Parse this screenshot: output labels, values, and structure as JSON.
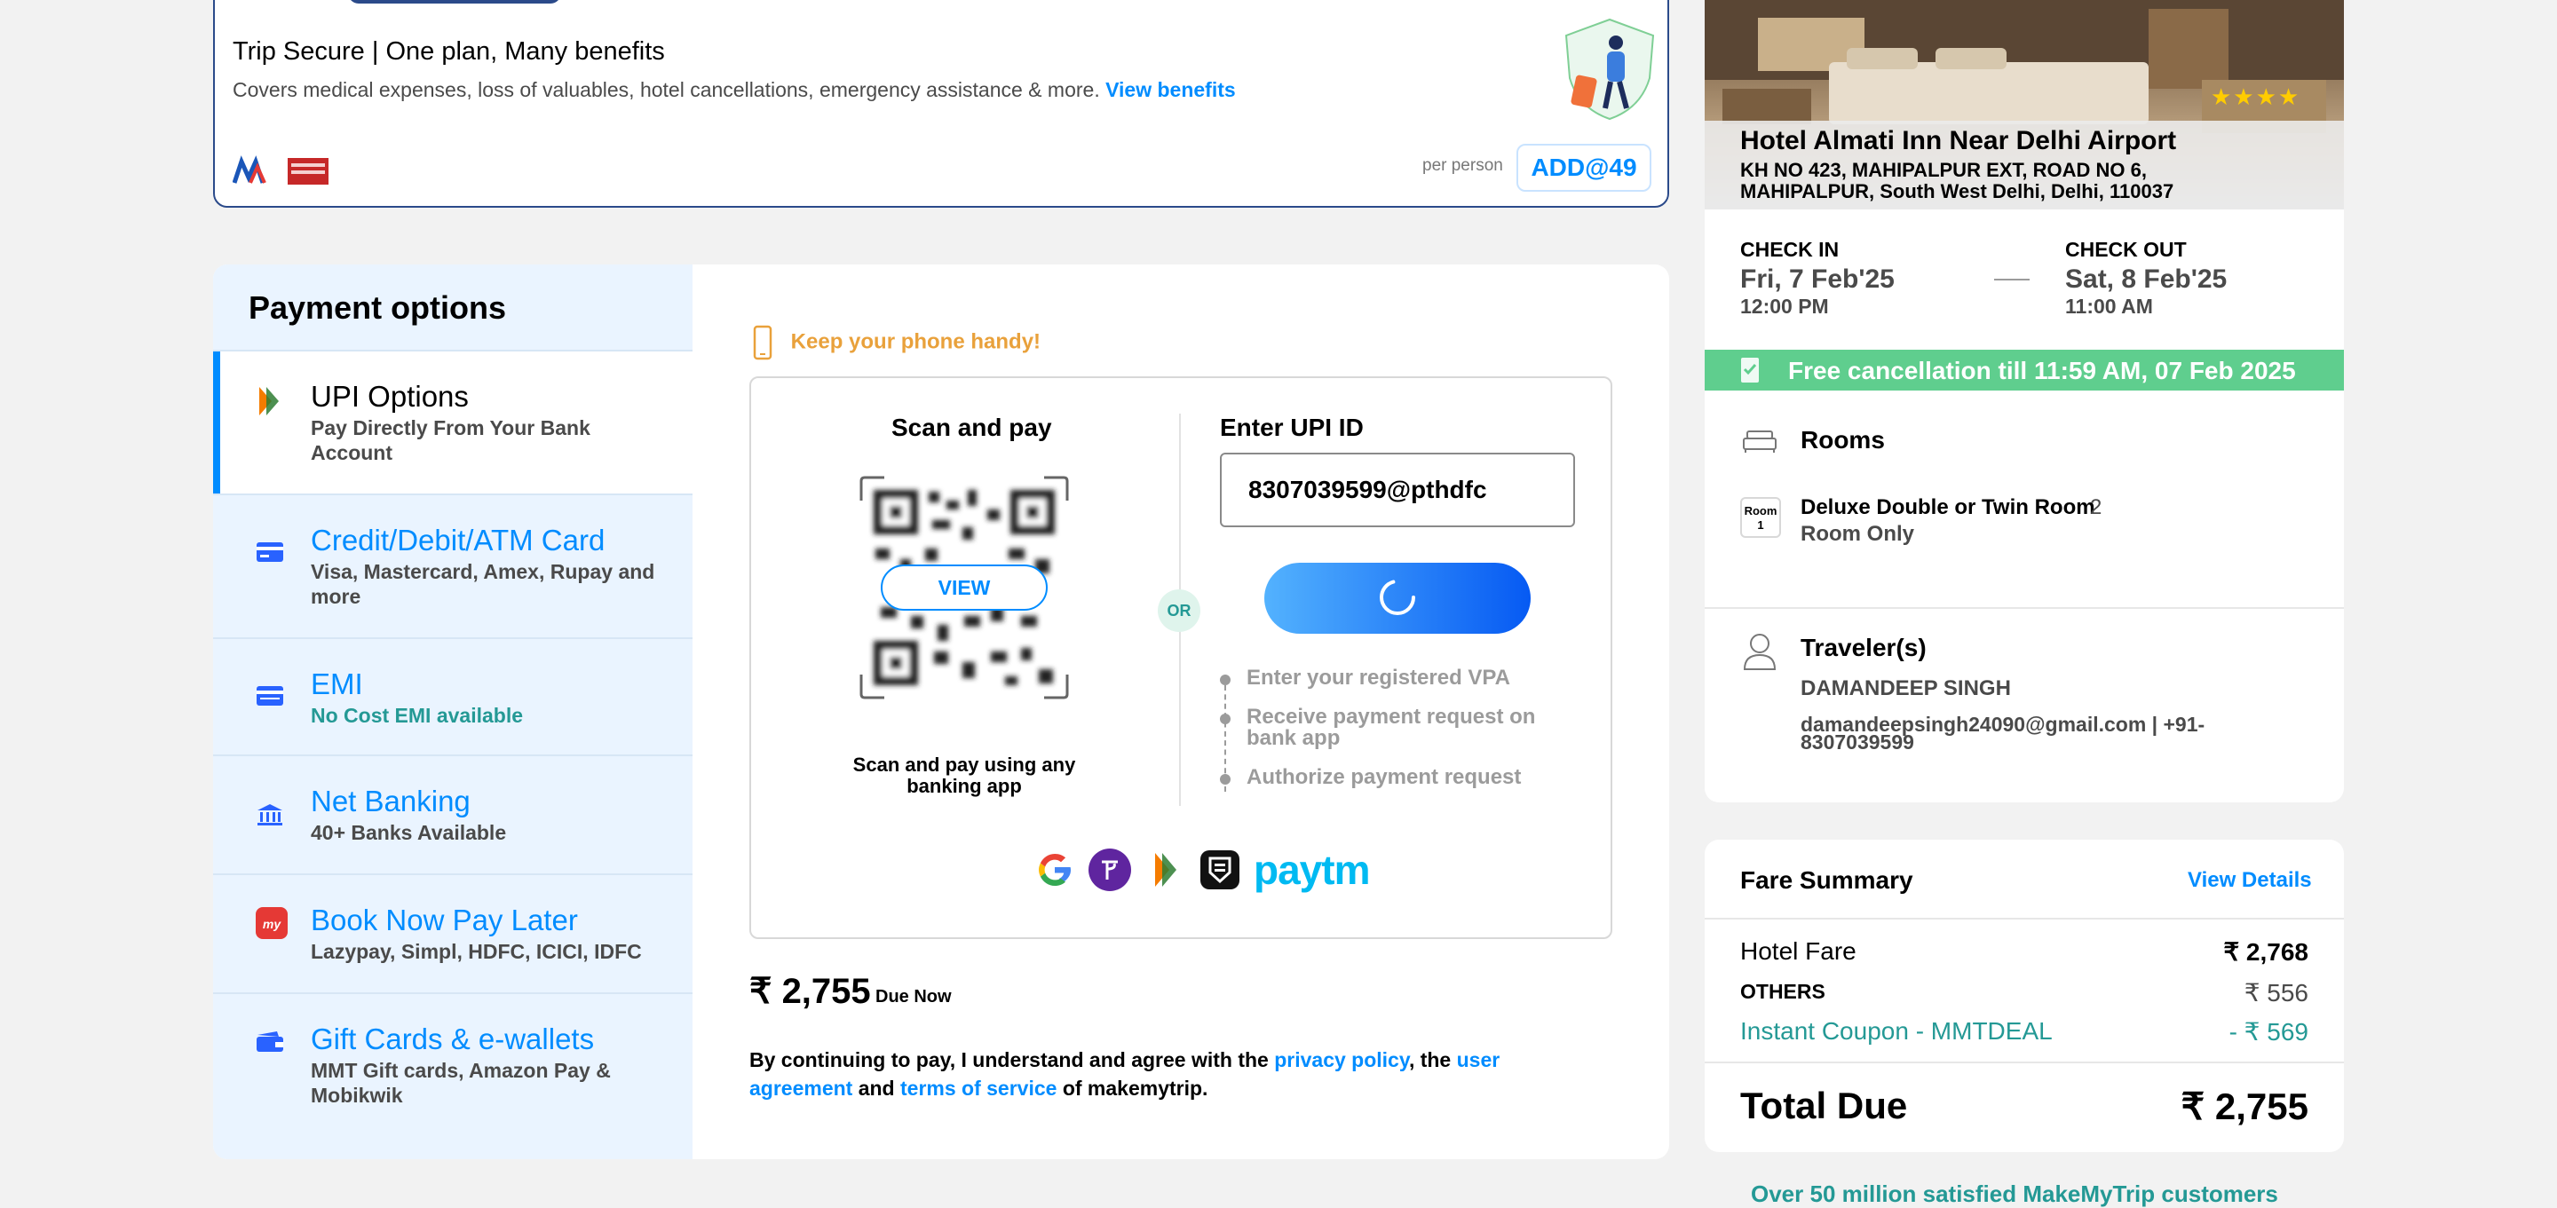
{
  "colors": {
    "brand_blue": "#008cff",
    "green": "#249995",
    "free_cancel_bg": "#5fce8e",
    "star": "#ffcc00"
  },
  "trip_secure": {
    "title": "Trip Secure | One plan, Many benefits",
    "description": "Covers medical expenses, loss of valuables, hotel cancellations, emergency assistance & more.",
    "view_benefits": "View benefits",
    "per_person": "per person",
    "add_button": "ADD@49"
  },
  "payment": {
    "heading": "Payment options",
    "options": [
      {
        "title": "UPI Options",
        "subtitle": "Pay Directly From Your Bank Account",
        "icon": "upi-icon"
      },
      {
        "title": "Credit/Debit/ATM Card",
        "subtitle": "Visa, Mastercard, Amex, Rupay and more",
        "icon": "card-icon"
      },
      {
        "title": "EMI",
        "subtitle": "No Cost EMI available",
        "icon": "emi-icon"
      },
      {
        "title": "Net Banking",
        "subtitle": "40+ Banks Available",
        "icon": "bank-icon"
      },
      {
        "title": "Book Now Pay Later",
        "subtitle": "Lazypay, Simpl, HDFC, ICICI, IDFC",
        "icon": "mmt-icon"
      },
      {
        "title": "Gift Cards & e-wallets",
        "subtitle": "MMT Gift cards, Amazon Pay & Mobikwik",
        "icon": "wallet-icon"
      }
    ],
    "phone_tip": "Keep your phone handy!",
    "scan_title": "Scan and pay",
    "qr_view": "VIEW",
    "scan_caption": "Scan and pay using any banking app",
    "or": "OR",
    "upi_label": "Enter UPI ID",
    "upi_value": "8307039599@pthdfc",
    "steps": [
      "Enter your registered VPA",
      "Receive payment request on bank app",
      "Authorize payment request"
    ],
    "apps": [
      "google-pay-icon",
      "phonepe-icon",
      "bhim-icon",
      "other-upi-icon",
      "paytm-icon"
    ],
    "paytm_text": "paytm",
    "due_amount": "₹ 2,755",
    "due_label": "Due Now",
    "terms": {
      "prefix": "By continuing to pay, I understand and agree with the ",
      "privacy": "privacy policy",
      "mid": ", the ",
      "agreement": "user agreement",
      "and": " and ",
      "tos": "terms of service",
      "suffix": " of makemytrip."
    }
  },
  "hotel": {
    "stars": "★★★★",
    "name": "Hotel Almati Inn Near Delhi Airport",
    "address": "KH NO 423, MAHIPALPUR EXT, ROAD NO 6, MAHIPALPUR, South West Delhi, Delhi, 110037",
    "check_in_label": "CHECK IN",
    "check_in_date": "Fri, 7 Feb'25",
    "check_in_time": "12:00 PM",
    "check_out_label": "CHECK OUT",
    "check_out_date": "Sat, 8 Feb'25",
    "check_out_time": "11:00 AM",
    "free_cancellation": "Free cancellation till 11:59 AM, 07 Feb 2025",
    "rooms_title": "Rooms",
    "room_badge_label": "Room",
    "room_badge_num": "1",
    "room_name": "Deluxe Double or Twin Room",
    "room_count": "2",
    "room_plan": "Room Only",
    "travelers_title": "Traveler(s)",
    "traveler_name": "DAMANDEEP SINGH",
    "traveler_contact": "damandeepsingh24090@gmail.com | +91-8307039599"
  },
  "fare": {
    "title": "Fare Summary",
    "view_details": "View Details",
    "hotel_fare_label": "Hotel Fare",
    "hotel_fare_value": "₹ 2,768",
    "others_label": "OTHERS",
    "others_value": "₹ 556",
    "coupon_label": "Instant Coupon - MMTDEAL",
    "coupon_value": "- ₹ 569",
    "total_label": "Total Due",
    "total_value": "₹ 2,755"
  },
  "social_proof": "Over 50 million satisfied MakeMyTrip customers"
}
